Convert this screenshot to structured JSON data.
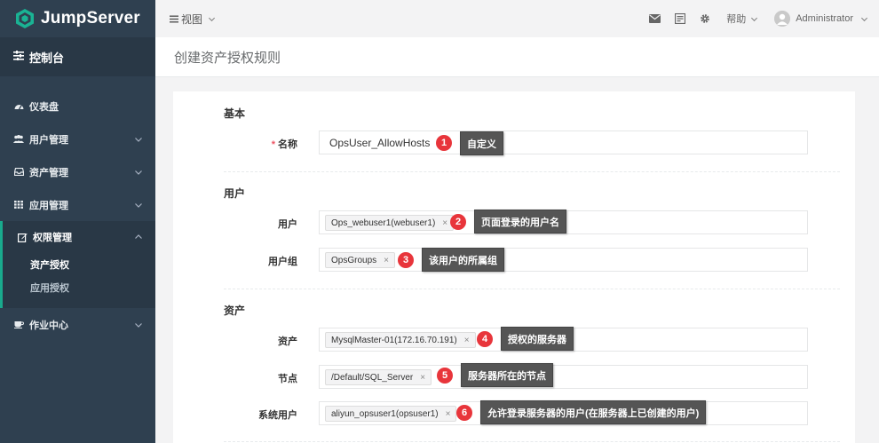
{
  "brand": {
    "name": "JumpServer",
    "color": "#1ab394"
  },
  "sidebar": {
    "console_label": "控制台",
    "items": [
      {
        "label": "仪表盘",
        "icon": "dashboard-icon"
      },
      {
        "label": "用户管理",
        "icon": "users-icon"
      },
      {
        "label": "资产管理",
        "icon": "inbox-icon"
      },
      {
        "label": "应用管理",
        "icon": "th-icon"
      },
      {
        "label": "权限管理",
        "icon": "edit-icon"
      },
      {
        "label": "作业中心",
        "icon": "coffee-icon"
      }
    ],
    "sub_items": [
      {
        "label": "资产授权"
      },
      {
        "label": "应用授权"
      }
    ]
  },
  "topbar": {
    "view_label": "视图",
    "help_label": "帮助",
    "user_name": "Administrator"
  },
  "page": {
    "title": "创建资产授权规则"
  },
  "form": {
    "sections": {
      "basic": "基本",
      "user": "用户",
      "asset": "资产"
    },
    "name_label": "名称",
    "name_value": "OpsUser_AllowHosts",
    "user_label": "用户",
    "user_tag": "Ops_webuser1(webuser1)",
    "usergroup_label": "用户组",
    "usergroup_tag": "OpsGroups",
    "asset_label": "资产",
    "asset_tag": "MysqlMaster-01(172.16.70.191)",
    "node_label": "节点",
    "node_tag": "/Default/SQL_Server",
    "sysuser_label": "系统用户",
    "sysuser_tag": "aliyun_opsuser1(opsuser1)",
    "remove_glyph": "×"
  },
  "annotations": [
    {
      "num": "1",
      "text": "自定义"
    },
    {
      "num": "2",
      "text": "页面登录的用户名"
    },
    {
      "num": "3",
      "text": "该用户的所属组"
    },
    {
      "num": "4",
      "text": "授权的服务器"
    },
    {
      "num": "5",
      "text": "服务器所在的节点"
    },
    {
      "num": "6",
      "text": "允许登录服务器的用户(在服务器上已创建的用户)"
    }
  ]
}
